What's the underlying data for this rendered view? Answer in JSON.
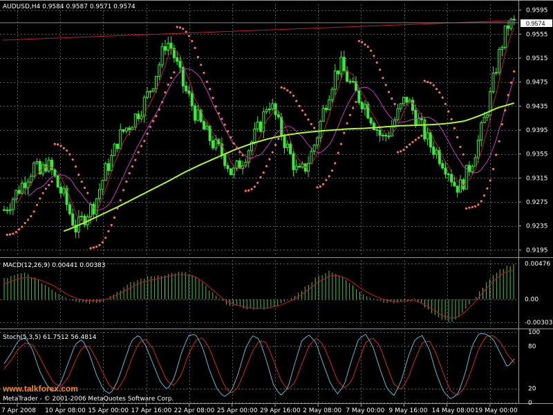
{
  "symbol_header": "AUDUSD,H4  0.9584 0.9587 0.9571 0.9574",
  "current_price_label": "0.9574",
  "macd_header": "MACD(12,26,9) 0.00441 0.00383",
  "stoch_header": "Stoch(5,3,5) 61.7512 56.4814",
  "copyright": "MetaTrader - © 2001-2006 MetaQuotes Software Corp.",
  "watermark": "www.talkforex.com",
  "colors": {
    "background": "#000000",
    "grid": "#5a5a5a",
    "candle": "#33ee33",
    "ma_fast": "#c41f1f",
    "ma_mid": "#cc33cc",
    "ma_slow": "#aaff22",
    "sar": "#ff6f5f",
    "trendline": "#c41f1f",
    "macd_hist": "#44cc44",
    "macd_signal": "#dd1111",
    "stoch_main": "#4fc0d0",
    "stoch_signal": "#dd2222",
    "axis_text": "#ffffff"
  },
  "chart_data": [
    {
      "type": "candlestick",
      "title": "AUDUSD,H4",
      "ohlc_last": {
        "open": 0.9584,
        "high": 0.9587,
        "low": 0.9571,
        "close": 0.9574
      },
      "y_ticks": [
        "0.9595",
        "0.9555",
        "0.9515",
        "0.9475",
        "0.9435",
        "0.9395",
        "0.9355",
        "0.9315",
        "0.9275",
        "0.9235",
        "0.9195"
      ],
      "ylim": [
        0.9185,
        0.9605
      ],
      "x_ticks": [
        "7 Apr 2008",
        "10 Apr 08:00",
        "15 Apr 00:00",
        "17 Apr 16:00",
        "22 Apr 08:00",
        "25 Apr 00:00",
        "29 Apr 16:00",
        "2 May 08:00",
        "7 May 00:00",
        "9 May 16:00",
        "14 May 08:00",
        "19 May 00:00"
      ],
      "grid": true,
      "close_series": [
        0.9262,
        0.9275,
        0.929,
        0.9305,
        0.932,
        0.9335,
        0.932,
        0.934,
        0.9325,
        0.93,
        0.9283,
        0.9255,
        0.923,
        0.9245,
        0.926,
        0.927,
        0.93,
        0.933,
        0.935,
        0.938,
        0.9395,
        0.9405,
        0.942,
        0.9435,
        0.9455,
        0.948,
        0.951,
        0.9545,
        0.953,
        0.9495,
        0.9465,
        0.9445,
        0.942,
        0.94,
        0.9385,
        0.937,
        0.936,
        0.9345,
        0.932,
        0.9335,
        0.935,
        0.937,
        0.939,
        0.941,
        0.9445,
        0.9425,
        0.9395,
        0.937,
        0.9345,
        0.932,
        0.933,
        0.935,
        0.938,
        0.942,
        0.9455,
        0.9485,
        0.9505,
        0.9485,
        0.9465,
        0.945,
        0.944,
        0.942,
        0.94,
        0.938,
        0.939,
        0.941,
        0.943,
        0.945,
        0.943,
        0.941,
        0.939,
        0.937,
        0.936,
        0.9345,
        0.933,
        0.9305,
        0.93,
        0.932,
        0.9345,
        0.9375,
        0.941,
        0.945,
        0.95,
        0.954,
        0.957,
        0.9574
      ],
      "sma_slow": [
        0.92,
        0.9205,
        0.9212,
        0.922,
        0.923,
        0.9242,
        0.9255,
        0.9268,
        0.9282,
        0.9296,
        0.931,
        0.9325,
        0.9338,
        0.935,
        0.9362,
        0.9372,
        0.938,
        0.9386,
        0.939,
        0.9393,
        0.9395,
        0.9397,
        0.9398,
        0.94,
        0.9402,
        0.9403,
        0.9404,
        0.9406,
        0.941,
        0.942,
        0.9432,
        0.944
      ],
      "current_price": 0.9574,
      "trendline_price_start": 0.9545,
      "trendline_price_end": 0.9578
    },
    {
      "type": "bar",
      "title": "MACD(12,26,9)",
      "values_text": {
        "macd": "0.00441",
        "signal": "0.00383"
      },
      "y_ticks": [
        "0.00476",
        "0.00",
        "-0.00303"
      ],
      "ylim": [
        -0.0036,
        0.0052
      ],
      "macd_hist": [
        0.0028,
        0.003,
        0.0033,
        0.0035,
        0.003,
        0.0024,
        0.0018,
        0.0012,
        0.0006,
        0.0002,
        -0.0002,
        -0.0004,
        -0.0005,
        -0.0004,
        -0.0002,
        0.0004,
        0.001,
        0.0016,
        0.0022,
        0.0026,
        0.0029,
        0.0031,
        0.0032,
        0.0033,
        0.0035,
        0.0036,
        0.0034,
        0.003,
        0.0022,
        0.0012,
        0.0004,
        -0.0004,
        -0.0008,
        -0.001,
        -0.0012,
        -0.0013,
        -0.0014,
        -0.0012,
        -0.001,
        -0.0007,
        -0.0002,
        0.0004,
        0.0012,
        0.002,
        0.0028,
        0.0034,
        0.0038,
        0.0034,
        0.0028,
        0.002,
        0.0012,
        0.0006,
        0.0002,
        -0.0002,
        -0.0004,
        -0.0005,
        -0.0004,
        -0.0002,
        0.0,
        -0.0006,
        -0.0014,
        -0.0022,
        -0.0028,
        -0.003,
        -0.0026,
        -0.0016,
        -0.0004,
        0.0008,
        0.002,
        0.003,
        0.0038,
        0.0044,
        0.0047
      ],
      "macd_signal": [
        0.002,
        0.0024,
        0.0027,
        0.0029,
        0.0028,
        0.0026,
        0.0022,
        0.0018,
        0.0012,
        0.0006,
        0.0002,
        -0.0001,
        -0.0002,
        -0.0002,
        -0.0001,
        0.0002,
        0.0006,
        0.0011,
        0.0016,
        0.0021,
        0.0024,
        0.0026,
        0.0028,
        0.003,
        0.0032,
        0.0033,
        0.0032,
        0.003,
        0.0024,
        0.0016,
        0.0008,
        0.0,
        -0.0005,
        -0.0008,
        -0.001,
        -0.0012,
        -0.0012,
        -0.0012,
        -0.001,
        -0.0008,
        -0.0004,
        0.0,
        0.0006,
        0.0013,
        0.002,
        0.0026,
        0.0031,
        0.0032,
        0.0029,
        0.0024,
        0.0017,
        0.0011,
        0.0006,
        0.0002,
        -0.0001,
        -0.0003,
        -0.0003,
        -0.0002,
        -0.0002,
        -0.0005,
        -0.001,
        -0.0016,
        -0.0022,
        -0.0025,
        -0.0024,
        -0.0018,
        -0.0009,
        0.0002,
        0.0013,
        0.0023,
        0.0031,
        0.0037,
        0.0038
      ]
    },
    {
      "type": "line",
      "title": "Stoch(5,3,5)",
      "values_text": {
        "main": "61.7512",
        "signal": "56.4814"
      },
      "y_ticks": [
        "100",
        "80",
        "20",
        "0"
      ],
      "ylim": [
        0,
        100
      ],
      "main": [
        55,
        70,
        88,
        92,
        75,
        45,
        25,
        15,
        28,
        55,
        82,
        90,
        70,
        40,
        18,
        12,
        30,
        60,
        88,
        96,
        80,
        55,
        30,
        18,
        35,
        70,
        95,
        97,
        78,
        45,
        20,
        8,
        15,
        40,
        75,
        95,
        90,
        60,
        25,
        10,
        20,
        55,
        88,
        96,
        85,
        55,
        28,
        12,
        25,
        60,
        90,
        97,
        80,
        48,
        20,
        10,
        30,
        65,
        90,
        95,
        75,
        40,
        15,
        5,
        12,
        40,
        80,
        98,
        97,
        90,
        70,
        50,
        62
      ],
      "signal": [
        48,
        60,
        76,
        85,
        82,
        65,
        45,
        28,
        22,
        35,
        58,
        78,
        80,
        62,
        40,
        22,
        18,
        35,
        62,
        85,
        90,
        76,
        52,
        30,
        24,
        40,
        68,
        88,
        92,
        76,
        50,
        25,
        12,
        22,
        46,
        72,
        88,
        85,
        60,
        32,
        18,
        28,
        55,
        80,
        92,
        82,
        58,
        32,
        20,
        30,
        58,
        85,
        92,
        80,
        52,
        26,
        18,
        35,
        62,
        85,
        88,
        68,
        40,
        16,
        10,
        22,
        48,
        78,
        94,
        95,
        86,
        68,
        56
      ]
    }
  ]
}
